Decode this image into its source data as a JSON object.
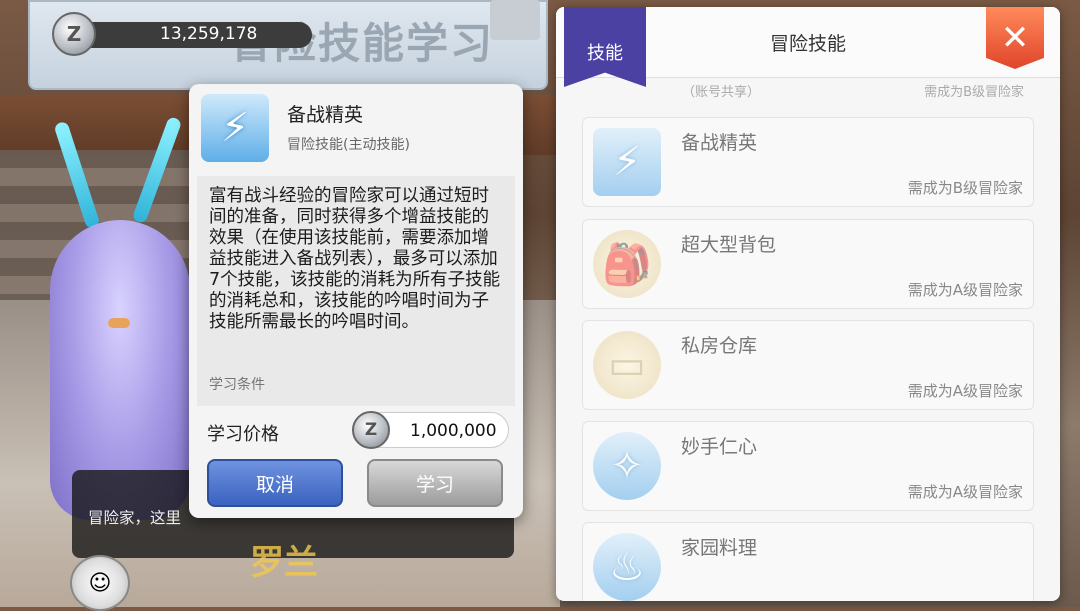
{
  "header": {
    "banner_title": "冒险技能学习",
    "currency_amount": "13,259,178",
    "currency_symbol": "Z"
  },
  "detail": {
    "skill_name": "备战精英",
    "skill_type": "冒险技能(主动技能)",
    "description": "富有战斗经验的冒险家可以通过短时间的准备，同时获得多个增益技能的效果（在使用该技能前，需要添加增益技能进入备战列表），最多可以添加7个技能，该技能的消耗为所有子技能的消耗总和，该技能的吟唱时间为子技能所需最长的吟唱时间。",
    "condition_label": "学习条件",
    "price_label": "学习价格",
    "price_value": "1,000,000",
    "cancel_label": "取消",
    "learn_label": "学习"
  },
  "chat": {
    "text": "冒险家，这里"
  },
  "npc_name": "罗兰",
  "panel": {
    "title": "冒险技能",
    "tag_label": "技能",
    "close_symbol": "✕",
    "peek_left": "（账号共享）",
    "peek_right": "需成为B级冒险家",
    "skills": [
      {
        "name": "备战精英",
        "requirement": "需成为B级冒险家",
        "icon": "battle-ready-icon"
      },
      {
        "name": "超大型背包",
        "requirement": "需成为A级冒险家",
        "icon": "backpack-icon"
      },
      {
        "name": "私房仓库",
        "requirement": "需成为A级冒险家",
        "icon": "storage-icon"
      },
      {
        "name": "妙手仁心",
        "requirement": "需成为A级冒险家",
        "icon": "healing-hand-icon"
      },
      {
        "name": "家园料理",
        "requirement": "",
        "icon": "home-cooking-icon"
      }
    ]
  },
  "colors": {
    "cancel_button": "#3a62bf",
    "learn_button": "#9c9c9c",
    "tag": "#4b41a3",
    "close_button": "#e0452a"
  }
}
